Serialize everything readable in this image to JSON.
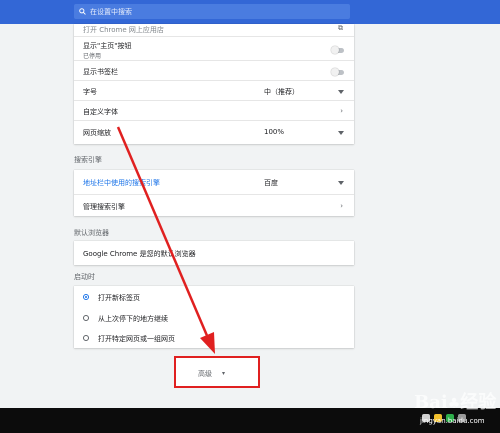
{
  "search": {
    "placeholder": "在设置中搜索"
  },
  "appearance": {
    "open_webstore": "打开 Chrome 网上应用店",
    "show_home_button": "显示\"主页\"按钮",
    "show_home_button_status": "已停用",
    "show_bookmarks_bar": "显示书签栏",
    "font_size_label": "字号",
    "font_size_value": "中（推荐）",
    "custom_fonts": "自定义字体",
    "page_zoom_label": "网页缩放",
    "page_zoom_value": "100%"
  },
  "search_engine": {
    "section_title": "搜索引擎",
    "address_bar_label": "地址栏中使用的搜索引擎",
    "address_bar_value": "百度",
    "manage": "管理搜索引擎"
  },
  "default_browser": {
    "section_title": "默认浏览器",
    "status": "Google Chrome 是您的默认浏览器"
  },
  "on_startup": {
    "section_title": "启动时",
    "options": [
      "打开新标签页",
      "从上次停下的地方继续",
      "打开特定网页或一组网页"
    ]
  },
  "advanced": {
    "label": "高级"
  },
  "watermark": {
    "url": "jingyan.baidu.com"
  },
  "colors": {
    "header": "#3367d6",
    "accent": "#1a73e8",
    "highlight": "#e02020"
  }
}
